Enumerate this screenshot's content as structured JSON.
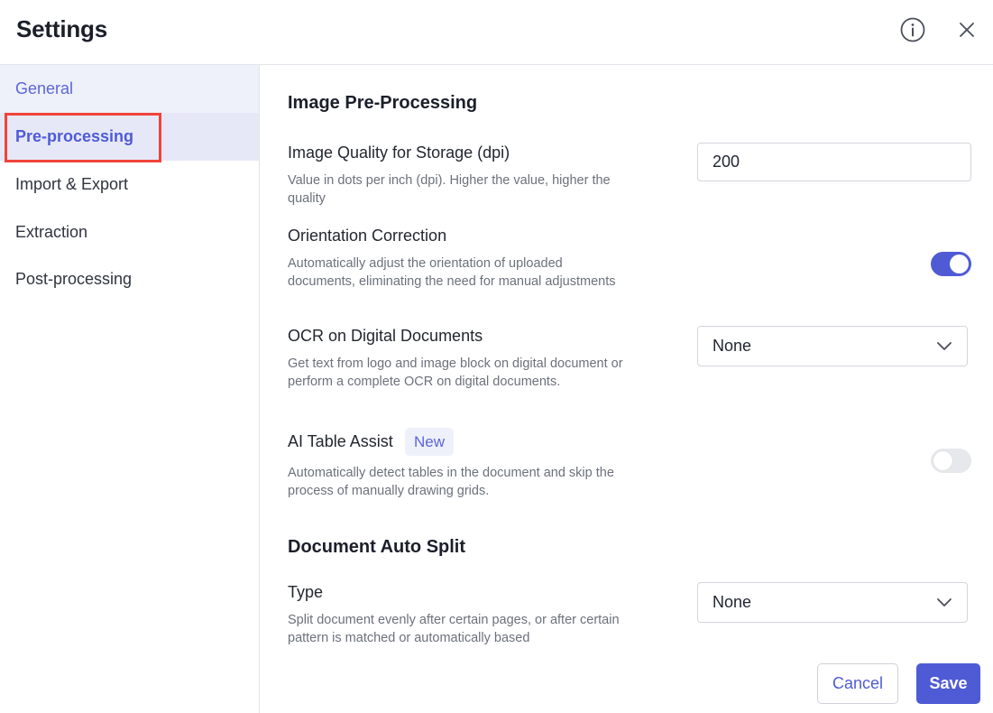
{
  "header": {
    "title": "Settings",
    "info_icon": "info-circle-icon",
    "close_icon": "close-icon"
  },
  "sidebar": {
    "items": [
      {
        "label": "General"
      },
      {
        "label": "Pre-processing"
      },
      {
        "label": "Import & Export"
      },
      {
        "label": "Extraction"
      },
      {
        "label": "Post-processing"
      }
    ],
    "active_index": 1
  },
  "main": {
    "image_section": {
      "title": "Image Pre-Processing",
      "quality": {
        "label": "Image Quality for Storage (dpi)",
        "description": "Value in dots per inch (dpi). Higher the value, higher the quality",
        "value": "200"
      },
      "orientation": {
        "label": "Orientation Correction",
        "description": "Automatically adjust the orientation of uploaded documents, eliminating the need for manual adjustments",
        "enabled": true
      },
      "ocr": {
        "label": "OCR on Digital Documents",
        "description": "Get text from logo and image block on digital document or perform a complete OCR on digital documents.",
        "selected": "None"
      },
      "ai_table": {
        "label": "AI Table Assist",
        "badge": "New",
        "description": "Automatically detect tables in the document and skip the process of manually drawing grids.",
        "enabled": false
      }
    },
    "split_section": {
      "title": "Document Auto Split",
      "type": {
        "label": "Type",
        "description": "Split document evenly after certain pages, or after certain pattern is matched or automatically based",
        "selected": "None"
      }
    }
  },
  "footer": {
    "cancel_label": "Cancel",
    "save_label": "Save"
  },
  "colors": {
    "accent": "#4f5bd5",
    "highlight_border": "#f0443a",
    "sidebar_active_bg": "#e6e8f7"
  }
}
